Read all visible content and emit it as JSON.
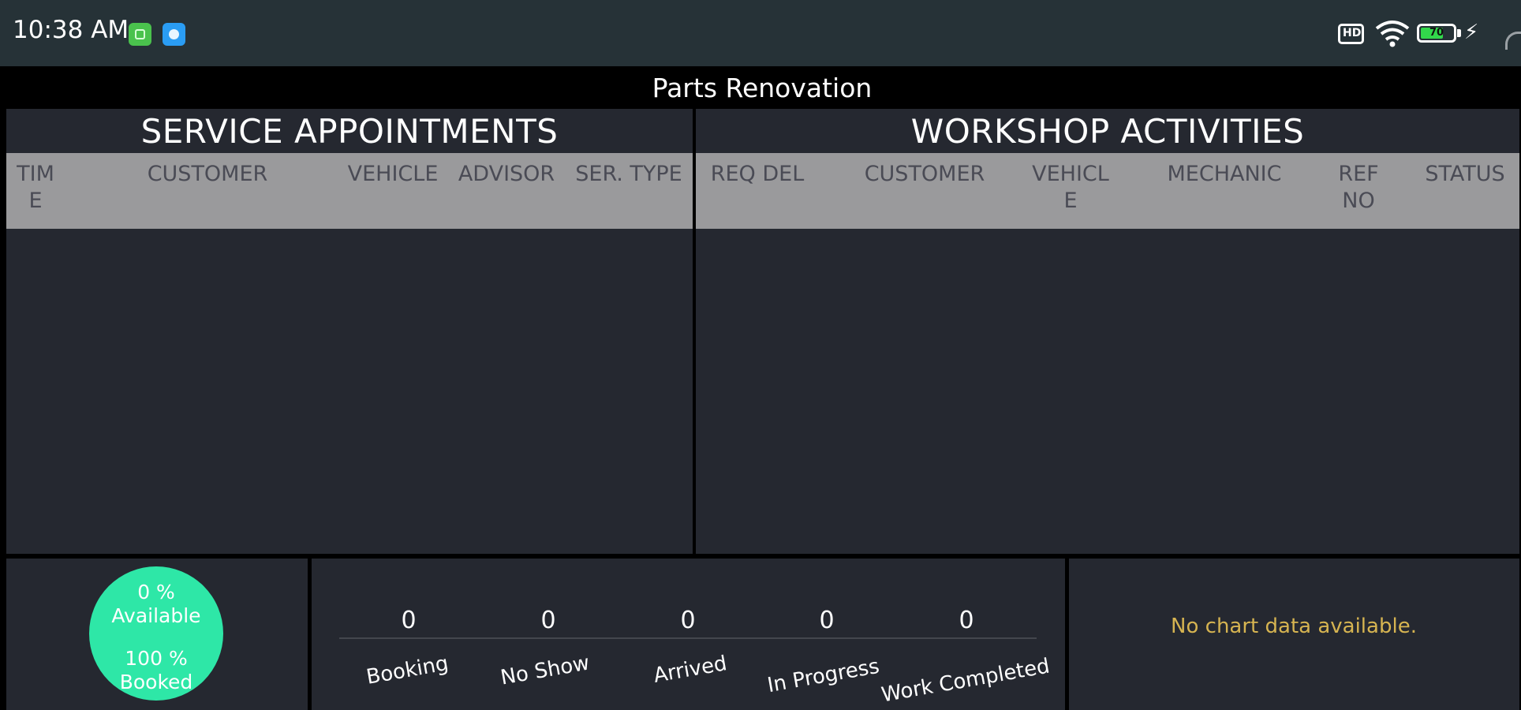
{
  "status_bar": {
    "time": "10:38 AM",
    "icons": [
      "app-notification-green-icon",
      "app-notification-blue-icon",
      "hd-cast-icon",
      "wifi-icon",
      "battery-icon",
      "charging-bolt-icon"
    ],
    "battery_level": "70",
    "battery_fraction": 0.7,
    "charging_glyph": "⚡"
  },
  "app": {
    "title": "Parts Renovation"
  },
  "service_appointments": {
    "title": "SERVICE APPOINTMENTS",
    "columns": [
      "TIM\nE",
      "CUSTOMER",
      "VEHICLE",
      "ADVISOR",
      "SER. TYPE"
    ],
    "rows": []
  },
  "workshop_activities": {
    "title": "WORKSHOP ACTIVITIES",
    "columns": [
      "REQ DEL",
      "CUSTOMER",
      "VEHICL\nE",
      "MECHANIC",
      "REF\nNO",
      "STATUS"
    ],
    "rows": []
  },
  "capacity": {
    "available_pct": "0 %",
    "available_label": "Available",
    "booked_pct": "100 %",
    "booked_label": "Booked",
    "color": "#2ee7a7"
  },
  "stats": [
    {
      "value": "0",
      "label": "Booking"
    },
    {
      "value": "0",
      "label": "No Show"
    },
    {
      "value": "0",
      "label": "Arrived"
    },
    {
      "value": "0",
      "label": "In Progress"
    },
    {
      "value": "0",
      "label": "Work Completed"
    }
  ],
  "chart_panel": {
    "message": "No chart data available.",
    "message_color": "#d6b451"
  }
}
